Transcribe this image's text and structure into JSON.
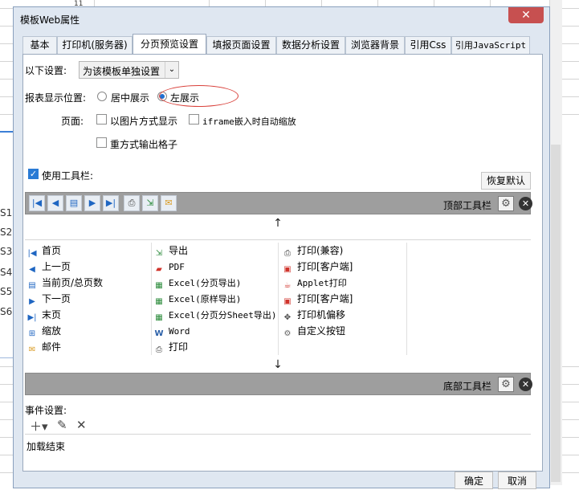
{
  "background": {
    "column_number": "11",
    "row_labels": [
      "S1",
      "S2",
      "S3",
      "S4",
      "S5",
      "S6"
    ]
  },
  "dialog": {
    "title": "模板Web属性",
    "close_symbol": "✕",
    "tabs": [
      {
        "label": "基本",
        "active": false
      },
      {
        "label": "打印机(服务器)",
        "active": false
      },
      {
        "label": "分页预览设置",
        "active": true
      },
      {
        "label": "填报页面设置",
        "active": false
      },
      {
        "label": "数据分析设置",
        "active": false
      },
      {
        "label": "浏览器背景",
        "active": false
      },
      {
        "label": "引用Css",
        "active": false
      },
      {
        "label": "引用JavaScript",
        "active": false
      }
    ],
    "ok_label": "确定",
    "cancel_label": "取消"
  },
  "settings": {
    "following_label": "以下设置:",
    "scope_value": "为该模板单独设置",
    "position_label": "报表显示位置:",
    "position_options": [
      {
        "label": "居中展示",
        "selected": false
      },
      {
        "label": "左展示",
        "selected": true
      }
    ],
    "page_label": "页面:",
    "checkboxes": [
      {
        "label": "以图片方式显示",
        "checked": false
      },
      {
        "label": "iframe嵌入时自动缩放",
        "checked": false
      },
      {
        "label": "重方式输出格子",
        "checked": false
      }
    ],
    "use_toolbar_label": "使用工具栏:",
    "use_toolbar_checked": true,
    "restore_default_label": "恢复默认"
  },
  "toolbars": {
    "top_label": "顶部工具栏",
    "bottom_label": "底部工具栏",
    "top_buttons": [
      "first-page",
      "prev-page",
      "page-count",
      "next-page",
      "last-page",
      "print",
      "export",
      "email"
    ],
    "move_up_symbol": "↑",
    "move_down_symbol": "↓"
  },
  "buttons_list": {
    "col1": [
      {
        "icon": "first-page",
        "label": "首页"
      },
      {
        "icon": "prev-page",
        "label": "上一页"
      },
      {
        "icon": "page-count",
        "label": "当前页/总页数"
      },
      {
        "icon": "next-page",
        "label": "下一页"
      },
      {
        "icon": "last-page",
        "label": "末页"
      },
      {
        "icon": "zoom",
        "label": "缩放"
      },
      {
        "icon": "email",
        "label": "邮件"
      }
    ],
    "col2": [
      {
        "icon": "export",
        "label": "导出"
      },
      {
        "icon": "pdf",
        "label": "PDF"
      },
      {
        "icon": "excel",
        "label": "Excel(分页导出)"
      },
      {
        "icon": "excel",
        "label": "Excel(原样导出)"
      },
      {
        "icon": "excel",
        "label": "Excel(分页分Sheet导出)"
      },
      {
        "icon": "word",
        "label": "Word"
      },
      {
        "icon": "print",
        "label": "打印"
      }
    ],
    "col3": [
      {
        "icon": "print",
        "label": "打印(兼容)"
      },
      {
        "icon": "print-client",
        "label": "打印[客户端]"
      },
      {
        "icon": "applet",
        "label": "Applet打印"
      },
      {
        "icon": "print-client",
        "label": "打印[客户端]"
      },
      {
        "icon": "move",
        "label": "打印机偏移"
      },
      {
        "icon": "gear",
        "label": "自定义按钮"
      }
    ]
  },
  "events": {
    "label": "事件设置:",
    "items": [
      "加载结束"
    ]
  },
  "colors": {
    "accent": "#1f6fd0",
    "ring": "#d9403a",
    "bar": "#9e9e9e",
    "close": "#c75050"
  }
}
